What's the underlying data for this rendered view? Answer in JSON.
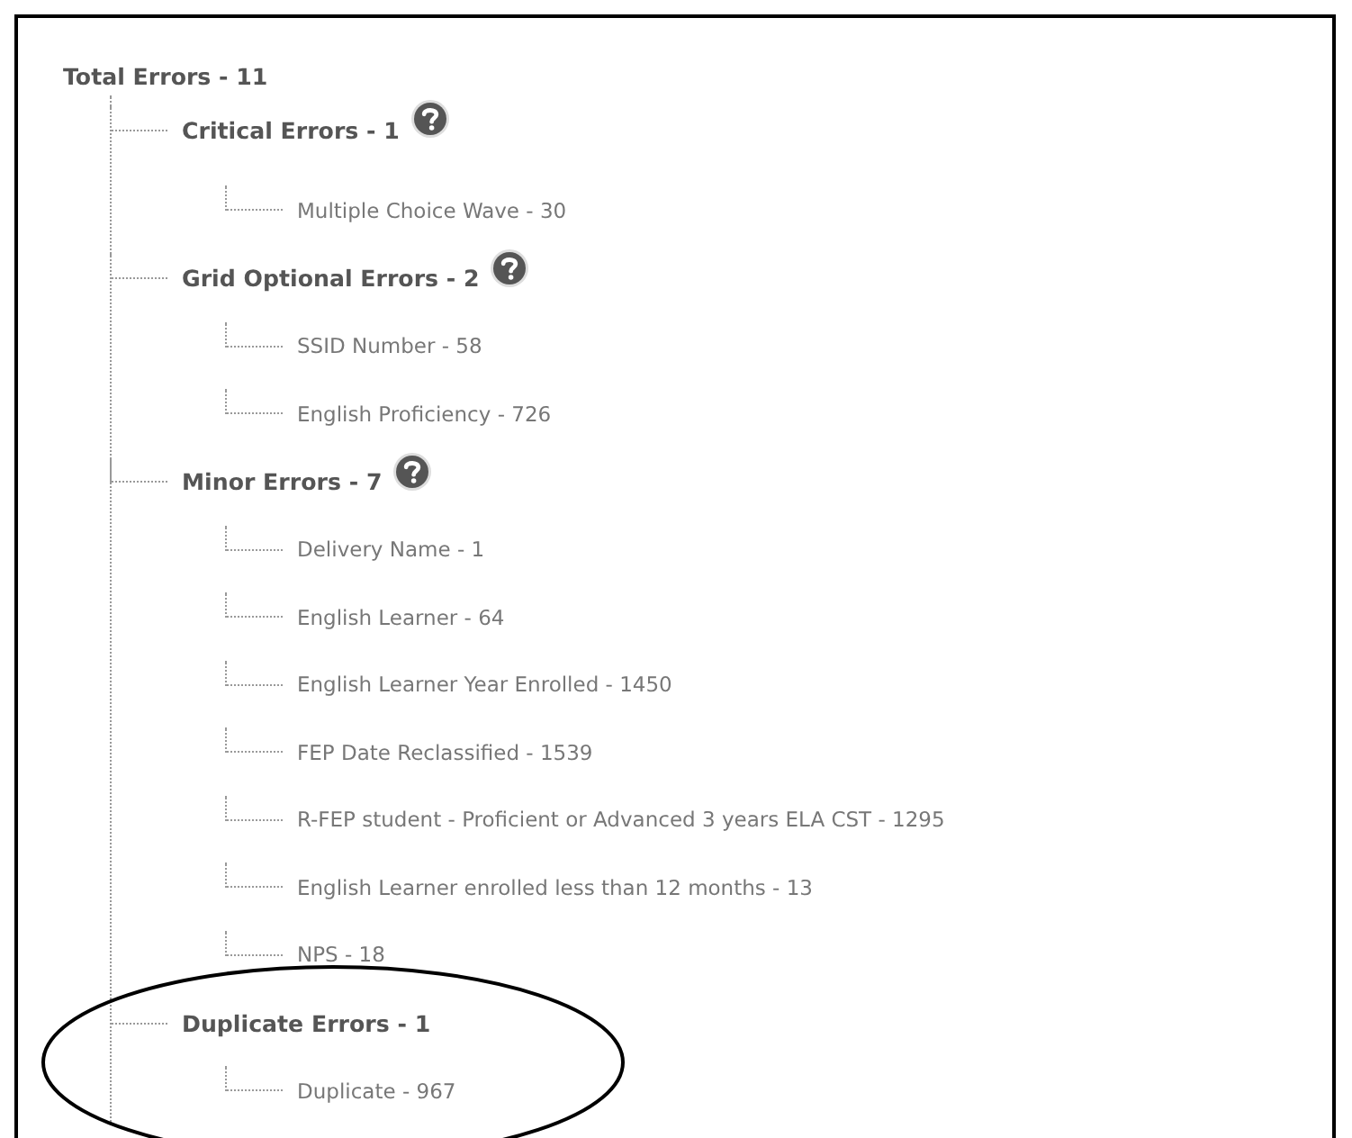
{
  "tree": {
    "label": "Total Errors - 11",
    "children": [
      {
        "label": "Critical Errors - 1",
        "help": true,
        "highlighted": false,
        "children": [
          {
            "label": "Multiple Choice Wave - 30"
          }
        ]
      },
      {
        "label": "Grid Optional Errors - 2",
        "help": true,
        "highlighted": false,
        "children": [
          {
            "label": "SSID Number - 58"
          },
          {
            "label": "English Proficiency - 726"
          }
        ]
      },
      {
        "label": "Minor Errors - 7",
        "help": true,
        "highlighted": false,
        "children": [
          {
            "label": "Delivery Name - 1"
          },
          {
            "label": "English Learner - 64"
          },
          {
            "label": "English Learner Year Enrolled - 1450"
          },
          {
            "label": "FEP Date Reclassified - 1539"
          },
          {
            "label": "R-FEP student - Proficient or Advanced 3 years ELA CST - 1295"
          },
          {
            "label": "English Learner enrolled less than 12 months - 13"
          },
          {
            "label": "NPS - 18"
          }
        ]
      },
      {
        "label": "Duplicate Errors - 1",
        "help": false,
        "highlighted": true,
        "children": [
          {
            "label": "Duplicate - 967"
          }
        ]
      }
    ]
  }
}
